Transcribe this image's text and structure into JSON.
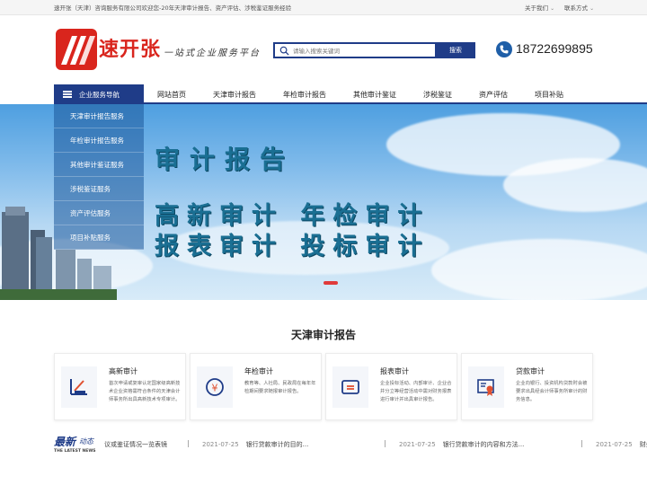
{
  "topbar": {
    "intro": "速开张（天津）咨询服务有限公司欢迎您-20年天津审计报告、资产评估、涉税鉴证服务经验",
    "about": "关于我们",
    "contact": "联系方式"
  },
  "header": {
    "logo_text": "速开张",
    "slogan": "一站式企业服务平台",
    "search_placeholder": "请输入搜索关键词",
    "search_button": "搜索",
    "phone": "18722699895"
  },
  "nav": {
    "service_label": "企业服务导航",
    "items": [
      "网站首页",
      "天津审计报告",
      "年检审计报告",
      "其他审计鉴证",
      "涉税鉴证",
      "资产评估",
      "项目补贴"
    ]
  },
  "sidemenu": [
    "天津审计报告服务",
    "年检审计报告服务",
    "其他审计鉴证服务",
    "涉税鉴证服务",
    "资产评估服务",
    "项目补贴服务"
  ],
  "banner": {
    "title": "审计报告",
    "line1": "高新审计  年检审计",
    "line2": "报表审计  投标审计"
  },
  "section": {
    "title": "天津审计报告",
    "cards": [
      {
        "title": "高新审计",
        "desc": "首次申请或复审认定国家级高新技术企业资格需符合条件的天津会计师事务所出具高新技术专项审计。",
        "icon": "chart-pen-icon"
      },
      {
        "title": "年检审计",
        "desc": "教育等、人社局、民政局在每年年检期间要求随报审计报告。",
        "icon": "yuan-coin-icon"
      },
      {
        "title": "报表审计",
        "desc": "企业投标活动、内部审计、企业合并分立等经营活动中需对财务报表进行审计并出具审计报告。",
        "icon": "report-card-icon"
      },
      {
        "title": "贷款审计",
        "desc": "企业向银行、投资机构贷款时会被要求出具经会计师事务所审计的财务信息。",
        "icon": "certificate-icon"
      }
    ]
  },
  "news": {
    "logo_big": "最新",
    "logo_small": "动态",
    "logo_en": "THE LATEST NEWS",
    "items": [
      {
        "date": "",
        "title": "议或鉴证情况一览表镜"
      },
      {
        "date": "2021-07-25",
        "title": "银行贷款审计的目的..."
      },
      {
        "date": "2021-07-25",
        "title": "银行贷款审计的内容和方法..."
      },
      {
        "date": "2021-07-25",
        "title": "财务"
      }
    ]
  },
  "colors": {
    "brand_red": "#d9251d",
    "brand_blue": "#1f3c88"
  }
}
